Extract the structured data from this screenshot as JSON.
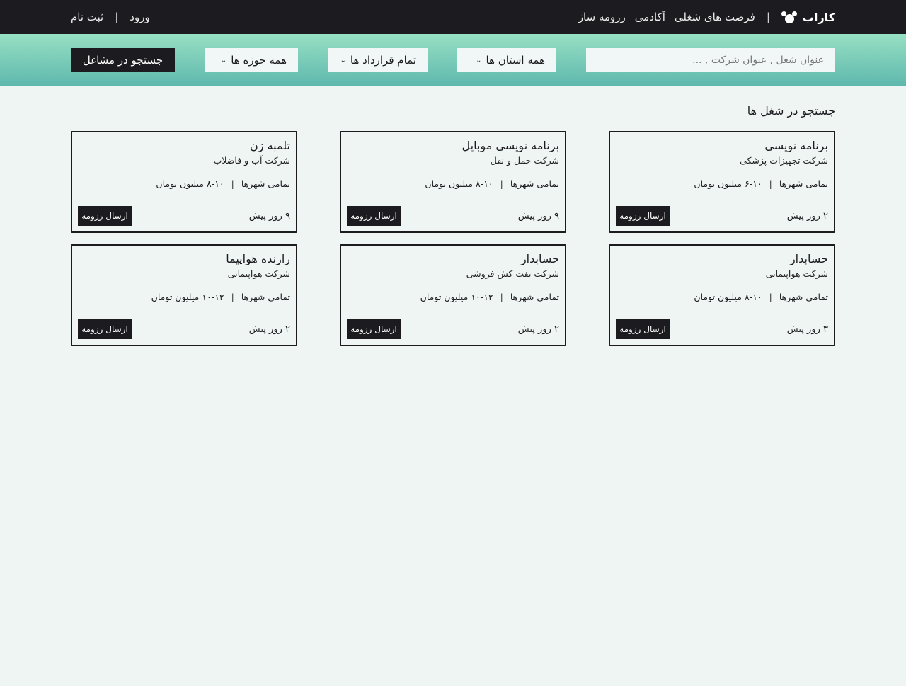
{
  "nav": {
    "brand": "کاراب",
    "links": [
      "فرصت های شغلی",
      "آکادمی",
      "رزومه ساز"
    ],
    "login": "ورود",
    "separator": "|",
    "register": "ثبت نام"
  },
  "search": {
    "placeholder": "عنوان شغل , عنوان شرکت , ...",
    "province": "همه استان ها",
    "contract": "تمام قرارداد ها",
    "field": "همه حوزه ها",
    "button": "جستجو در مشاغل"
  },
  "page_title": "جستجو در شغل ها",
  "jobs": [
    {
      "title": "برنامه نویسی",
      "company": "شرکت تجهیزات پزشکی",
      "city": "تمامی شهرها",
      "salary": "۶-۱۰ میلیون تومان",
      "posted": "۲ روز پیش",
      "apply": "ارسال رزومه"
    },
    {
      "title": "برنامه نویسی موبایل",
      "company": "شرکت حمل و نقل",
      "city": "تمامی شهرها",
      "salary": "۸-۱۰ میلیون تومان",
      "posted": "۹ روز پیش",
      "apply": "ارسال رزومه"
    },
    {
      "title": "تلمبه زن",
      "company": "شرکت آب و فاضلاب",
      "city": "تمامی شهرها",
      "salary": "۸-۱۰ میلیون تومان",
      "posted": "۹ روز پیش",
      "apply": "ارسال رزومه"
    },
    {
      "title": "حسابدار",
      "company": "شرکت هواپیمایی",
      "city": "تمامی شهرها",
      "salary": "۸-۱۰ میلیون تومان",
      "posted": "۳ روز پیش",
      "apply": "ارسال رزومه"
    },
    {
      "title": "حسابدار",
      "company": "شرکت نفت کش فروشی",
      "city": "تمامی شهرها",
      "salary": "۱۰-۱۲ میلیون تومان",
      "posted": "۲ روز پیش",
      "apply": "ارسال رزومه"
    },
    {
      "title": "رارنده هواپیما",
      "company": "شرکت هواپیمایی",
      "city": "تمامی شهرها",
      "salary": "۱۰-۱۲ میلیون تومان",
      "posted": "۲ روز پیش",
      "apply": "ارسال رزومه"
    }
  ],
  "colors": {
    "dark": "#1c1b1f",
    "background": "#eef5f3",
    "gradient_top": "#97e0c3",
    "gradient_bottom": "#5fb8ae"
  },
  "icons": {
    "logo": "brand-logo-icon",
    "dropdown": "chevron-down-icon"
  }
}
